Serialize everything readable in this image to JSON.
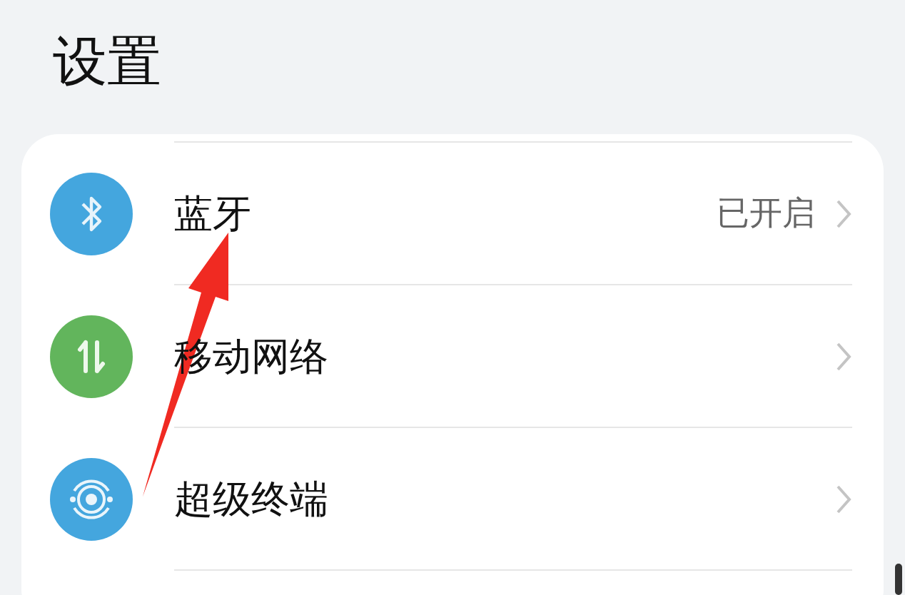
{
  "title": "设置",
  "items": [
    {
      "kind": "bluetooth",
      "color": "#44a6de",
      "label": "蓝牙",
      "value": "已开启"
    },
    {
      "kind": "data",
      "color": "#62b55c",
      "label": "移动网络"
    },
    {
      "kind": "orbit",
      "color": "#44a6de",
      "label": "超级终端"
    }
  ]
}
